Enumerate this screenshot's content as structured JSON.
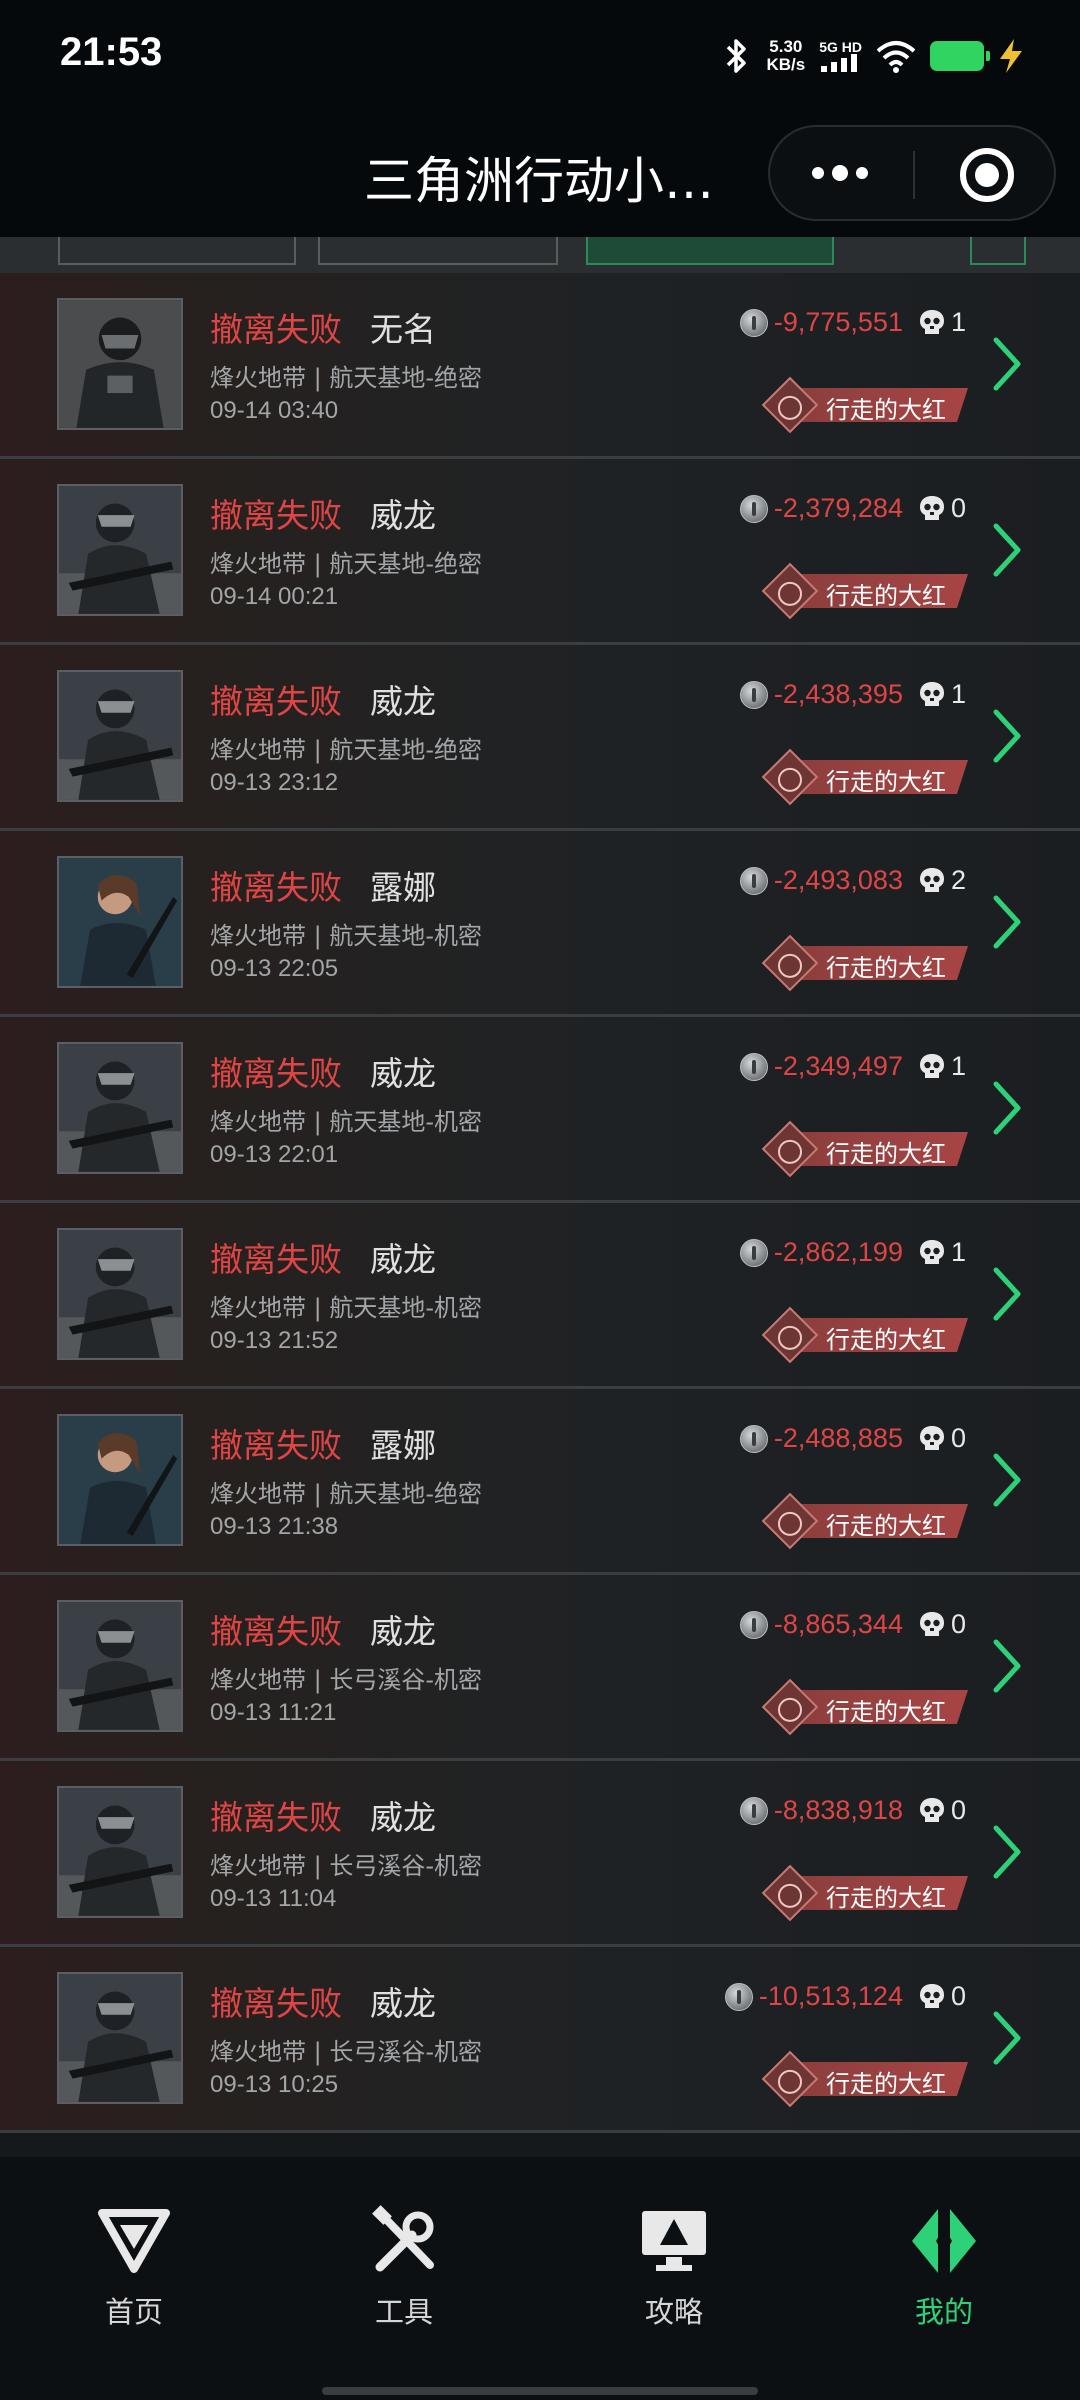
{
  "status_bar": {
    "time": "21:53",
    "net_speed": "5.30",
    "net_unit": "KB/s",
    "network": "5G HD",
    "battery_color": "#2fd461"
  },
  "header": {
    "title": "三角洲行动小…"
  },
  "records": [
    {
      "status": "撤离失败",
      "operator": "无名",
      "avatar": "nameless",
      "map": "烽火地带 | 航天基地-绝密",
      "time": "09-14 03:40",
      "value": "-9,775,551",
      "kills": "1",
      "badge": "行走的大红"
    },
    {
      "status": "撤离失败",
      "operator": "威龙",
      "avatar": "weilong",
      "map": "烽火地带 | 航天基地-绝密",
      "time": "09-14 00:21",
      "value": "-2,379,284",
      "kills": "0",
      "badge": "行走的大红"
    },
    {
      "status": "撤离失败",
      "operator": "威龙",
      "avatar": "weilong",
      "map": "烽火地带 | 航天基地-绝密",
      "time": "09-13 23:12",
      "value": "-2,438,395",
      "kills": "1",
      "badge": "行走的大红"
    },
    {
      "status": "撤离失败",
      "operator": "露娜",
      "avatar": "luna",
      "map": "烽火地带 | 航天基地-机密",
      "time": "09-13 22:05",
      "value": "-2,493,083",
      "kills": "2",
      "badge": "行走的大红"
    },
    {
      "status": "撤离失败",
      "operator": "威龙",
      "avatar": "weilong",
      "map": "烽火地带 | 航天基地-机密",
      "time": "09-13 22:01",
      "value": "-2,349,497",
      "kills": "1",
      "badge": "行走的大红"
    },
    {
      "status": "撤离失败",
      "operator": "威龙",
      "avatar": "weilong",
      "map": "烽火地带 | 航天基地-机密",
      "time": "09-13 21:52",
      "value": "-2,862,199",
      "kills": "1",
      "badge": "行走的大红"
    },
    {
      "status": "撤离失败",
      "operator": "露娜",
      "avatar": "luna",
      "map": "烽火地带 | 航天基地-绝密",
      "time": "09-13 21:38",
      "value": "-2,488,885",
      "kills": "0",
      "badge": "行走的大红"
    },
    {
      "status": "撤离失败",
      "operator": "威龙",
      "avatar": "weilong",
      "map": "烽火地带 | 长弓溪谷-机密",
      "time": "09-13 11:21",
      "value": "-8,865,344",
      "kills": "0",
      "badge": "行走的大红"
    },
    {
      "status": "撤离失败",
      "operator": "威龙",
      "avatar": "weilong",
      "map": "烽火地带 | 长弓溪谷-机密",
      "time": "09-13 11:04",
      "value": "-8,838,918",
      "kills": "0",
      "badge": "行走的大红"
    },
    {
      "status": "撤离失败",
      "operator": "威龙",
      "avatar": "weilong",
      "map": "烽火地带 | 长弓溪谷-机密",
      "time": "09-13 10:25",
      "value": "-10,513,124",
      "kills": "0",
      "badge": "行走的大红"
    }
  ],
  "colors": {
    "fail": "#e04545",
    "accent": "#2fd178",
    "badge": "#a84545"
  },
  "nav": [
    {
      "label": "首页",
      "icon": "home-triangle-icon",
      "active": false
    },
    {
      "label": "工具",
      "icon": "tools-icon",
      "active": false
    },
    {
      "label": "攻略",
      "icon": "guide-monitor-icon",
      "active": false
    },
    {
      "label": "我的",
      "icon": "profile-logo-icon",
      "active": true
    }
  ]
}
